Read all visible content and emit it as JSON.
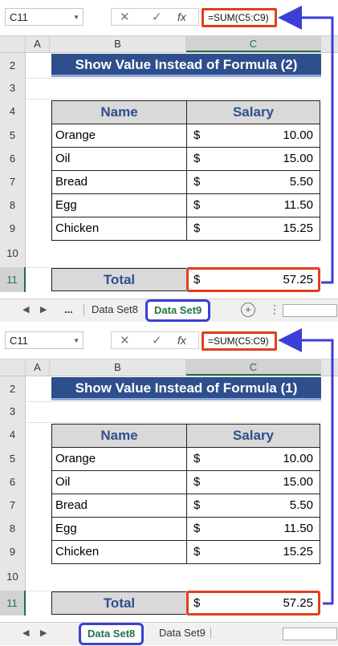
{
  "top": {
    "name_box": "C11",
    "formula": "=SUM(C5:C9)",
    "columns": [
      "A",
      "B",
      "C"
    ],
    "rows": [
      "2",
      "3",
      "4",
      "5",
      "6",
      "7",
      "8",
      "9",
      "10",
      "11"
    ],
    "title": "Show Value Instead of Formula (2)",
    "table": {
      "headers": [
        "Name",
        "Salary"
      ],
      "rows": [
        {
          "name": "Orange",
          "currency": "$",
          "amount": "10.00"
        },
        {
          "name": "Oil",
          "currency": "$",
          "amount": "15.00"
        },
        {
          "name": "Bread",
          "currency": "$",
          "amount": "5.50"
        },
        {
          "name": "Egg",
          "currency": "$",
          "amount": "11.50"
        },
        {
          "name": "Chicken",
          "currency": "$",
          "amount": "15.25"
        }
      ],
      "total_label": "Total",
      "total_currency": "$",
      "total_amount": "57.25"
    },
    "tabs": {
      "ellipsis": "...",
      "items": [
        "Data Set8",
        "Data Set9"
      ],
      "active": "Data Set9"
    }
  },
  "bottom": {
    "name_box": "C11",
    "formula": "=SUM(C5:C9)",
    "columns": [
      "A",
      "B",
      "C"
    ],
    "rows": [
      "2",
      "3",
      "4",
      "5",
      "6",
      "7",
      "8",
      "9",
      "10",
      "11"
    ],
    "title": "Show Value Instead of Formula (1)",
    "table": {
      "headers": [
        "Name",
        "Salary"
      ],
      "rows": [
        {
          "name": "Orange",
          "currency": "$",
          "amount": "10.00"
        },
        {
          "name": "Oil",
          "currency": "$",
          "amount": "15.00"
        },
        {
          "name": "Bread",
          "currency": "$",
          "amount": "5.50"
        },
        {
          "name": "Egg",
          "currency": "$",
          "amount": "11.50"
        },
        {
          "name": "Chicken",
          "currency": "$",
          "amount": "15.25"
        }
      ],
      "total_label": "Total",
      "total_currency": "$",
      "total_amount": "57.25"
    },
    "tabs": {
      "items": [
        "Data Set8",
        "Data Set9"
      ],
      "active": "Data Set8"
    }
  },
  "icons": {
    "cancel": "✕",
    "confirm": "✓",
    "function": "fx",
    "add_sheet": "⊕"
  },
  "colors": {
    "title_bg": "#2f4e8c",
    "highlight_box": "#e0401a",
    "arrow": "#3b3fd6",
    "tab_active_text": "#217346"
  }
}
